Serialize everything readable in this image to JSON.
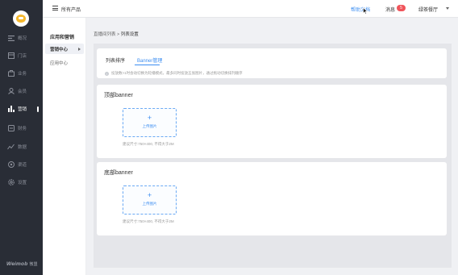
{
  "rail": {
    "items": [
      {
        "label": "概况",
        "icon": "dashboard-icon"
      },
      {
        "label": "门店",
        "icon": "store-icon"
      },
      {
        "label": "业务",
        "icon": "business-icon"
      },
      {
        "label": "会员",
        "icon": "member-icon"
      },
      {
        "label": "营销",
        "icon": "marketing-chart-icon",
        "active": true
      },
      {
        "label": "财务",
        "icon": "finance-icon"
      },
      {
        "label": "数据",
        "icon": "data-trend-icon"
      },
      {
        "label": "渠道",
        "icon": "channel-icon"
      },
      {
        "label": "设置",
        "icon": "settings-icon"
      }
    ],
    "brand": "Weimob",
    "brand_sub": "微盟"
  },
  "topbar": {
    "all_products": "所有产品",
    "help": "帮助文档",
    "messages": "消息",
    "message_count": "5",
    "store": "绿茶餐厅"
  },
  "subnav": {
    "title": "应用和营销",
    "items": [
      "营销中心",
      "应用中心"
    ]
  },
  "breadcrumb": {
    "parent": "直播间列表",
    "separator": ">",
    "current": "列表设置"
  },
  "tabs": [
    "列表排序",
    "Banner管理"
  ],
  "tip": "投放数>1时会动切换为轮播模式，最多同时投放五张图片，通过拖动切换排列顺序",
  "sections": [
    {
      "title": "顶部banner",
      "upload_label": "上传图片",
      "hint": "建议尺寸:750×400, 不得大于2M"
    },
    {
      "title": "底部banner",
      "upload_label": "上传图片",
      "hint": "建议尺寸:750×400, 不得大于2M"
    }
  ],
  "colors": {
    "accent": "#3c8ef1",
    "rail_bg": "#292d36",
    "badge": "#f0545a"
  }
}
